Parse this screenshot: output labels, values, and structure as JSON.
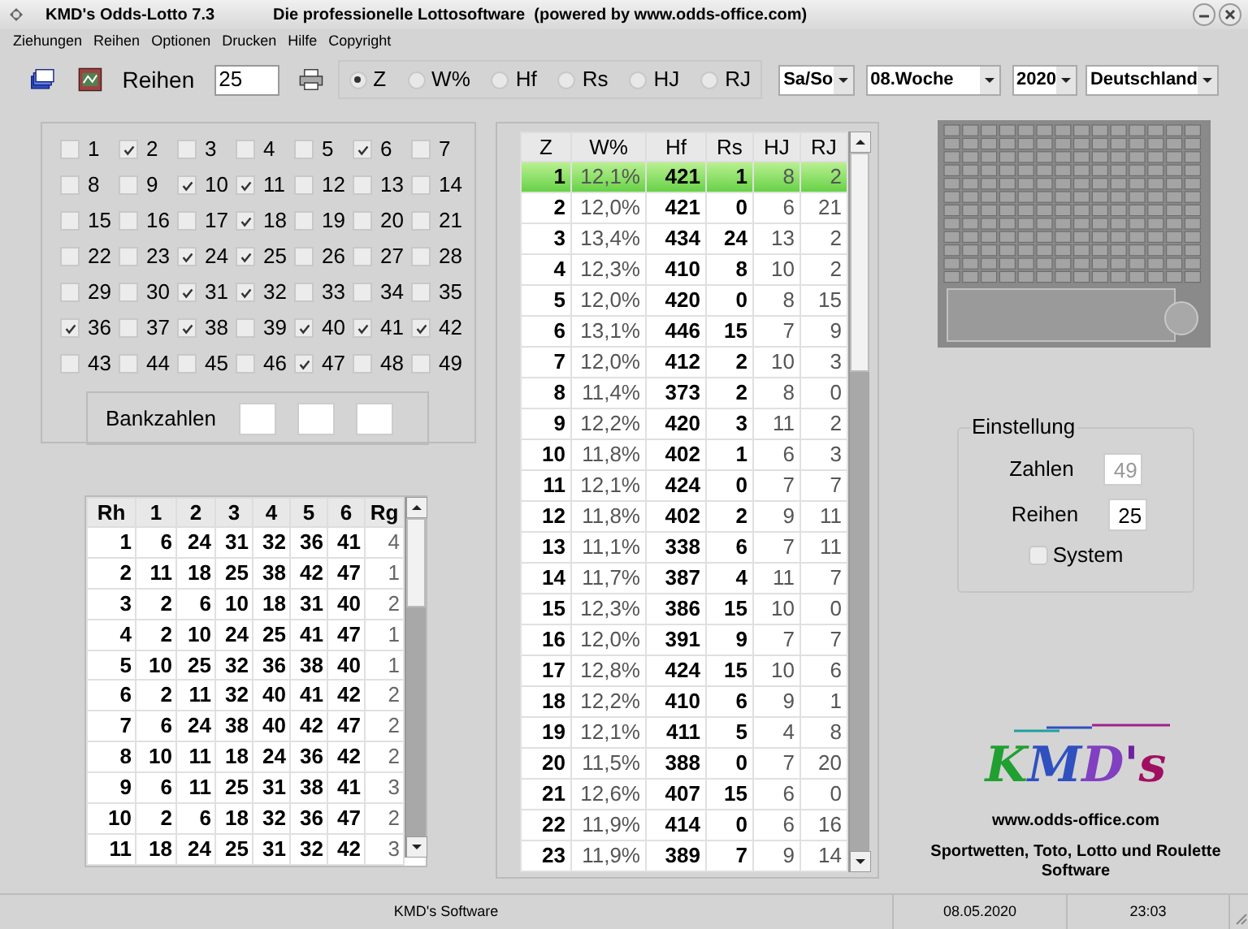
{
  "window": {
    "title": "KMD's Odds-Lotto 7.3",
    "subtitle": "Die professionelle Lottosoftware  (powered by www.odds-office.com)"
  },
  "menu": [
    "Ziehungen",
    "Reihen",
    "Optionen",
    "Drucken",
    "Hilfe",
    "Copyright"
  ],
  "toolbar": {
    "reihen_label": "Reihen",
    "reihen_value": "25",
    "sort_options": [
      {
        "label": "Z",
        "selected": true
      },
      {
        "label": "W%",
        "selected": false
      },
      {
        "label": "Hf",
        "selected": false
      },
      {
        "label": "Rs",
        "selected": false
      },
      {
        "label": "HJ",
        "selected": false
      },
      {
        "label": "RJ",
        "selected": false
      }
    ],
    "dropdowns": [
      "Sa/So",
      "08.Woche",
      "2020",
      "Deutschland"
    ]
  },
  "numbers": [
    {
      "label": "1",
      "checked": false
    },
    {
      "label": "2",
      "checked": true
    },
    {
      "label": "3",
      "checked": false
    },
    {
      "label": "4",
      "checked": false
    },
    {
      "label": "5",
      "checked": false
    },
    {
      "label": "6",
      "checked": true
    },
    {
      "label": "7",
      "checked": false
    },
    {
      "label": "8",
      "checked": false
    },
    {
      "label": "9",
      "checked": false
    },
    {
      "label": "10",
      "checked": true
    },
    {
      "label": "11",
      "checked": true
    },
    {
      "label": "12",
      "checked": false
    },
    {
      "label": "13",
      "checked": false
    },
    {
      "label": "14",
      "checked": false
    },
    {
      "label": "15",
      "checked": false
    },
    {
      "label": "16",
      "checked": false
    },
    {
      "label": "17",
      "checked": false
    },
    {
      "label": "18",
      "checked": true
    },
    {
      "label": "19",
      "checked": false
    },
    {
      "label": "20",
      "checked": false
    },
    {
      "label": "21",
      "checked": false
    },
    {
      "label": "22",
      "checked": false
    },
    {
      "label": "23",
      "checked": false
    },
    {
      "label": "24",
      "checked": true
    },
    {
      "label": "25",
      "checked": true
    },
    {
      "label": "26",
      "checked": false
    },
    {
      "label": "27",
      "checked": false
    },
    {
      "label": "28",
      "checked": false
    },
    {
      "label": "29",
      "checked": false
    },
    {
      "label": "30",
      "checked": false
    },
    {
      "label": "31",
      "checked": true
    },
    {
      "label": "32",
      "checked": true
    },
    {
      "label": "33",
      "checked": false
    },
    {
      "label": "34",
      "checked": false
    },
    {
      "label": "35",
      "checked": false
    },
    {
      "label": "36",
      "checked": true
    },
    {
      "label": "37",
      "checked": false
    },
    {
      "label": "38",
      "checked": true
    },
    {
      "label": "39",
      "checked": false
    },
    {
      "label": "40",
      "checked": true
    },
    {
      "label": "41",
      "checked": true
    },
    {
      "label": "42",
      "checked": true
    },
    {
      "label": "43",
      "checked": false
    },
    {
      "label": "44",
      "checked": false
    },
    {
      "label": "45",
      "checked": false
    },
    {
      "label": "46",
      "checked": false
    },
    {
      "label": "47",
      "checked": true
    },
    {
      "label": "48",
      "checked": false
    },
    {
      "label": "49",
      "checked": false
    }
  ],
  "bankzahlen": {
    "label": "Bankzahlen"
  },
  "reihen_table": {
    "columns": [
      "Rh",
      "1",
      "2",
      "3",
      "4",
      "5",
      "6",
      "Rg"
    ],
    "rows": [
      [
        "1",
        "6",
        "24",
        "31",
        "32",
        "36",
        "41",
        "4"
      ],
      [
        "2",
        "11",
        "18",
        "25",
        "38",
        "42",
        "47",
        "1"
      ],
      [
        "3",
        "2",
        "6",
        "10",
        "18",
        "31",
        "40",
        "2"
      ],
      [
        "4",
        "2",
        "10",
        "24",
        "25",
        "41",
        "47",
        "1"
      ],
      [
        "5",
        "10",
        "25",
        "32",
        "36",
        "38",
        "40",
        "1"
      ],
      [
        "6",
        "2",
        "11",
        "32",
        "40",
        "41",
        "42",
        "2"
      ],
      [
        "7",
        "6",
        "24",
        "38",
        "40",
        "42",
        "47",
        "2"
      ],
      [
        "8",
        "10",
        "11",
        "18",
        "24",
        "36",
        "42",
        "2"
      ],
      [
        "9",
        "6",
        "11",
        "25",
        "31",
        "38",
        "41",
        "3"
      ],
      [
        "10",
        "2",
        "6",
        "18",
        "32",
        "36",
        "47",
        "2"
      ],
      [
        "11",
        "18",
        "24",
        "25",
        "31",
        "32",
        "42",
        "3"
      ]
    ]
  },
  "stats_table": {
    "columns": [
      "Z",
      "W%",
      "Hf",
      "Rs",
      "HJ",
      "RJ"
    ],
    "rows": [
      {
        "cells": [
          "1",
          "12,1%",
          "421",
          "1",
          "8",
          "2"
        ],
        "selected": true
      },
      {
        "cells": [
          "2",
          "12,0%",
          "421",
          "0",
          "6",
          "21"
        ],
        "selected": false
      },
      {
        "cells": [
          "3",
          "13,4%",
          "434",
          "24",
          "13",
          "2"
        ],
        "selected": false
      },
      {
        "cells": [
          "4",
          "12,3%",
          "410",
          "8",
          "10",
          "2"
        ],
        "selected": false
      },
      {
        "cells": [
          "5",
          "12,0%",
          "420",
          "0",
          "8",
          "15"
        ],
        "selected": false
      },
      {
        "cells": [
          "6",
          "13,1%",
          "446",
          "15",
          "7",
          "9"
        ],
        "selected": false
      },
      {
        "cells": [
          "7",
          "12,0%",
          "412",
          "2",
          "10",
          "3"
        ],
        "selected": false
      },
      {
        "cells": [
          "8",
          "11,4%",
          "373",
          "2",
          "8",
          "0"
        ],
        "selected": false
      },
      {
        "cells": [
          "9",
          "12,2%",
          "420",
          "3",
          "11",
          "2"
        ],
        "selected": false
      },
      {
        "cells": [
          "10",
          "11,8%",
          "402",
          "1",
          "6",
          "3"
        ],
        "selected": false
      },
      {
        "cells": [
          "11",
          "12,1%",
          "424",
          "0",
          "7",
          "7"
        ],
        "selected": false
      },
      {
        "cells": [
          "12",
          "11,8%",
          "402",
          "2",
          "9",
          "11"
        ],
        "selected": false
      },
      {
        "cells": [
          "13",
          "11,1%",
          "338",
          "6",
          "7",
          "11"
        ],
        "selected": false
      },
      {
        "cells": [
          "14",
          "11,7%",
          "387",
          "4",
          "11",
          "7"
        ],
        "selected": false
      },
      {
        "cells": [
          "15",
          "12,3%",
          "386",
          "15",
          "10",
          "0"
        ],
        "selected": false
      },
      {
        "cells": [
          "16",
          "12,0%",
          "391",
          "9",
          "7",
          "7"
        ],
        "selected": false
      },
      {
        "cells": [
          "17",
          "12,8%",
          "424",
          "15",
          "10",
          "6"
        ],
        "selected": false
      },
      {
        "cells": [
          "18",
          "12,2%",
          "410",
          "6",
          "9",
          "1"
        ],
        "selected": false
      },
      {
        "cells": [
          "19",
          "12,1%",
          "411",
          "5",
          "4",
          "8"
        ],
        "selected": false
      },
      {
        "cells": [
          "20",
          "11,5%",
          "388",
          "0",
          "7",
          "20"
        ],
        "selected": false
      },
      {
        "cells": [
          "21",
          "12,6%",
          "407",
          "15",
          "6",
          "0"
        ],
        "selected": false
      },
      {
        "cells": [
          "22",
          "11,9%",
          "414",
          "0",
          "6",
          "16"
        ],
        "selected": false
      },
      {
        "cells": [
          "23",
          "11,9%",
          "389",
          "7",
          "9",
          "14"
        ],
        "selected": false
      }
    ]
  },
  "einstellung": {
    "title": "Einstellung",
    "zahlen_label": "Zahlen",
    "zahlen_value": "49",
    "zahlen_disabled": true,
    "reihen_label": "Reihen",
    "reihen_value": "25",
    "system_label": "System",
    "system_checked": false
  },
  "branding": {
    "logo": "KMD's",
    "url": "www.odds-office.com",
    "tagline": "Sportwetten, Toto, Lotto und Roulette Software"
  },
  "status_bar": [
    "KMD's Software",
    "08.05.2020",
    "23:03"
  ]
}
